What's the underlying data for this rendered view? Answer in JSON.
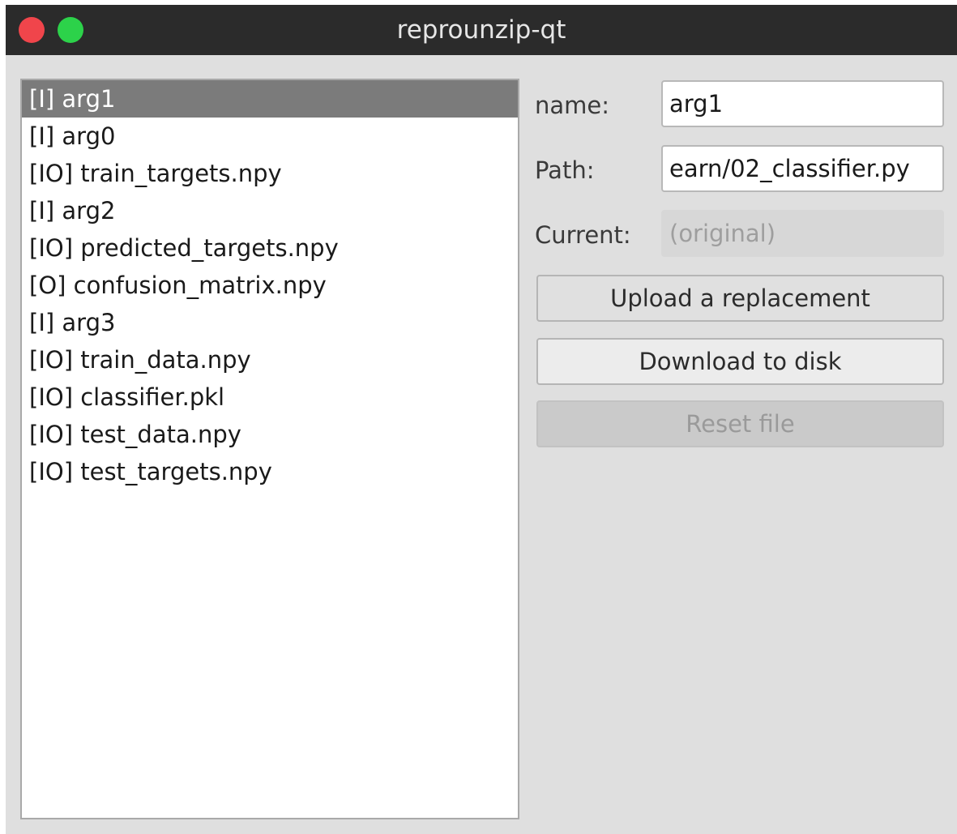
{
  "window": {
    "title": "reprounzip-qt"
  },
  "file_list": {
    "selected_index": 0,
    "items": [
      "[I] arg1",
      "[I] arg0",
      "[IO] train_targets.npy",
      "[I] arg2",
      "[IO] predicted_targets.npy",
      "[O] confusion_matrix.npy",
      "[I] arg3",
      "[IO] train_data.npy",
      "[IO] classifier.pkl",
      "[IO] test_data.npy",
      "[IO] test_targets.npy"
    ]
  },
  "details": {
    "name_label": "name:",
    "name_value": "arg1",
    "path_label": "Path:",
    "path_value": "earn/02_classifier.py",
    "current_label": "Current:",
    "current_value": "(original)"
  },
  "actions": {
    "upload_label": "Upload a replacement",
    "download_label": "Download to disk",
    "reset_label": "Reset file"
  },
  "colors": {
    "titlebar": "#2b2b2b",
    "close": "#f0454b",
    "zoom": "#2cd24a",
    "selection": "#7b7b7b"
  }
}
